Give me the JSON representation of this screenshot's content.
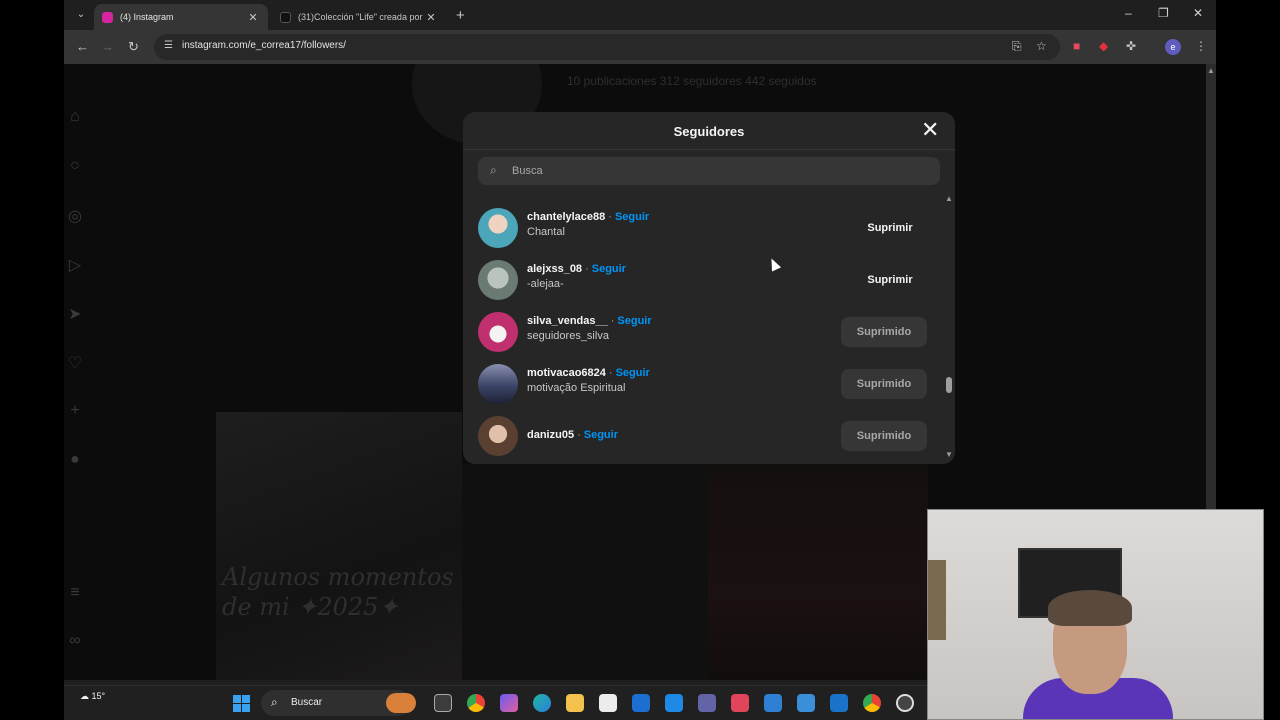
{
  "browser": {
    "tabs": [
      {
        "title": "(4) Instagram",
        "active": true,
        "favicon_color": "#d6249f"
      },
      {
        "title": "(31)Colección \"Life\" creada por",
        "active": false,
        "favicon_color": "#111111"
      }
    ],
    "url": "instagram.com/e_correa17/followers/",
    "profile_initial": "e",
    "window_controls": {
      "minimize": "–",
      "restore": "❐",
      "close": "✕"
    }
  },
  "background_profile": {
    "stats": "10 publicaciones   312 seguidores   442 seguidos",
    "post_text": "Algunos momentos\nde mi ✦2025✦"
  },
  "modal": {
    "title": "Seguidores",
    "search_placeholder": "Busca",
    "follow_label": "Seguir",
    "remove_label": "Suprimir",
    "removed_label": "Suprimido",
    "followers": [
      {
        "username": "chantelylace88",
        "fullname": "Chantal",
        "state": "remove",
        "avatar_color": "#4aa6b8"
      },
      {
        "username": "alejxss_08",
        "fullname": "-alejaa-",
        "state": "remove",
        "avatar_color": "#7c8a80"
      },
      {
        "username": "silva_vendas__",
        "fullname": "seguidores_silva",
        "state": "removed",
        "avatar_color": "#c0306e"
      },
      {
        "username": "motivacao6824",
        "fullname": "motivação Espiritual",
        "state": "removed",
        "avatar_color": "#3b4466"
      },
      {
        "username": "danizu05",
        "fullname": "",
        "state": "removed",
        "avatar_color": "#8a6a5a"
      }
    ]
  },
  "taskbar": {
    "weather": "15°",
    "search_label": "Buscar"
  }
}
